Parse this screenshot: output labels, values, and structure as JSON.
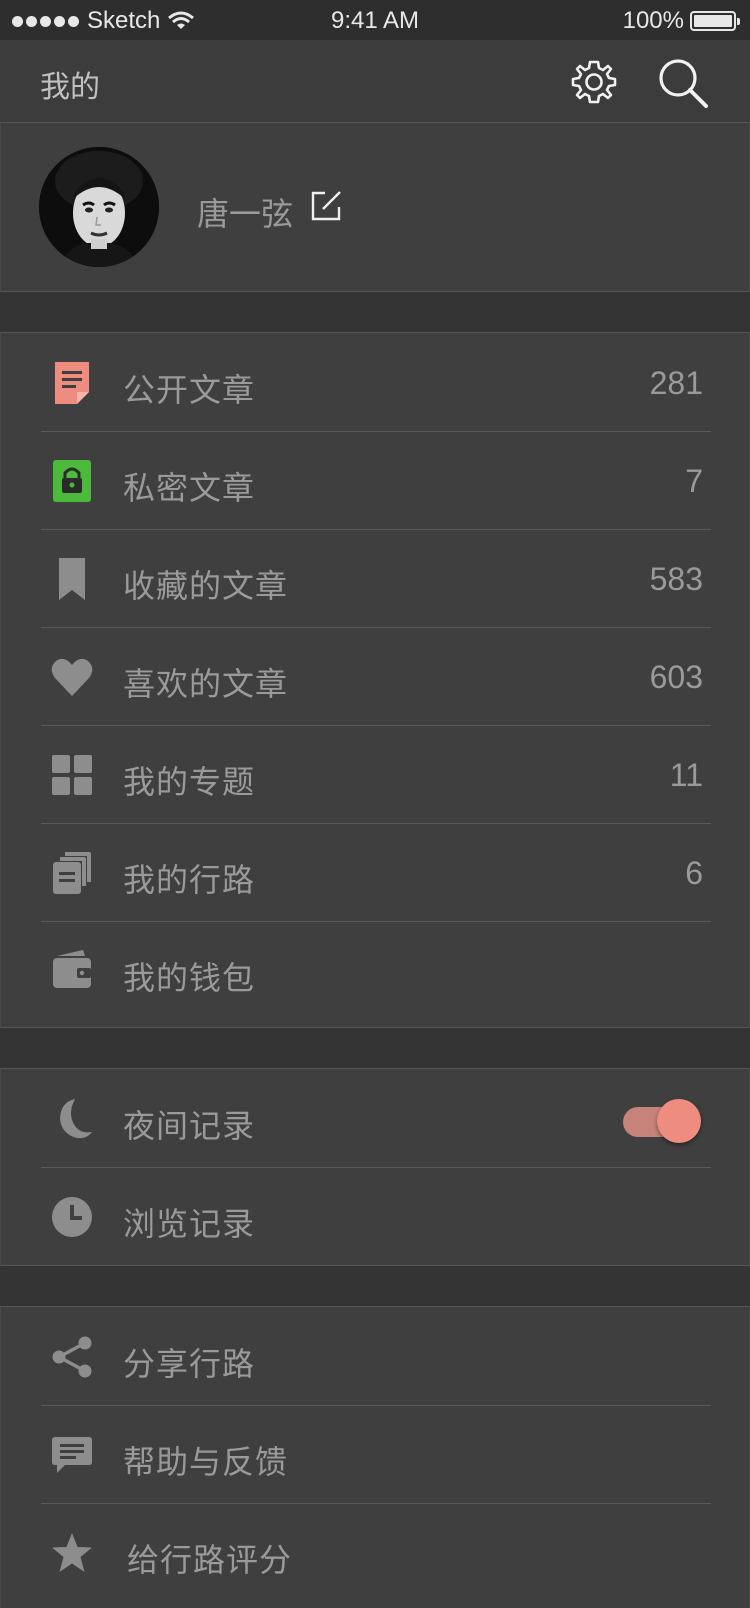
{
  "status_bar": {
    "carrier": "Sketch",
    "time": "9:41 AM",
    "battery": "100%"
  },
  "nav": {
    "title": "我的"
  },
  "profile": {
    "name": "唐一弦"
  },
  "articles": [
    {
      "label": "公开文章",
      "count": "281",
      "icon": "document-icon",
      "icon_color": "#ef8c80"
    },
    {
      "label": "私密文章",
      "count": "7",
      "icon": "lock-icon",
      "icon_color": "#4cbb3c"
    },
    {
      "label": "收藏的文章",
      "count": "583",
      "icon": "bookmark-icon",
      "icon_color": "#8d8d8d"
    },
    {
      "label": "喜欢的文章",
      "count": "603",
      "icon": "heart-icon",
      "icon_color": "#8d8d8d"
    },
    {
      "label": "我的专题",
      "count": "11",
      "icon": "grid-icon",
      "icon_color": "#8d8d8d"
    },
    {
      "label": "我的行路",
      "count": "6",
      "icon": "notebook-icon",
      "icon_color": "#8d8d8d"
    },
    {
      "label": "我的钱包",
      "count": "",
      "icon": "wallet-icon",
      "icon_color": "#8d8d8d"
    }
  ],
  "records": [
    {
      "label": "夜间记录",
      "icon": "moon-icon",
      "toggle_on": true
    },
    {
      "label": "浏览记录",
      "icon": "clock-icon"
    }
  ],
  "more": [
    {
      "label": "分享行路",
      "icon": "share-icon"
    },
    {
      "label": "帮助与反馈",
      "icon": "message-icon"
    },
    {
      "label": "给行路评分",
      "icon": "star-icon"
    }
  ],
  "colors": {
    "accent": "#ef8c80",
    "green": "#4cbb3c",
    "background": "#343434",
    "card": "#3f3f3f"
  }
}
